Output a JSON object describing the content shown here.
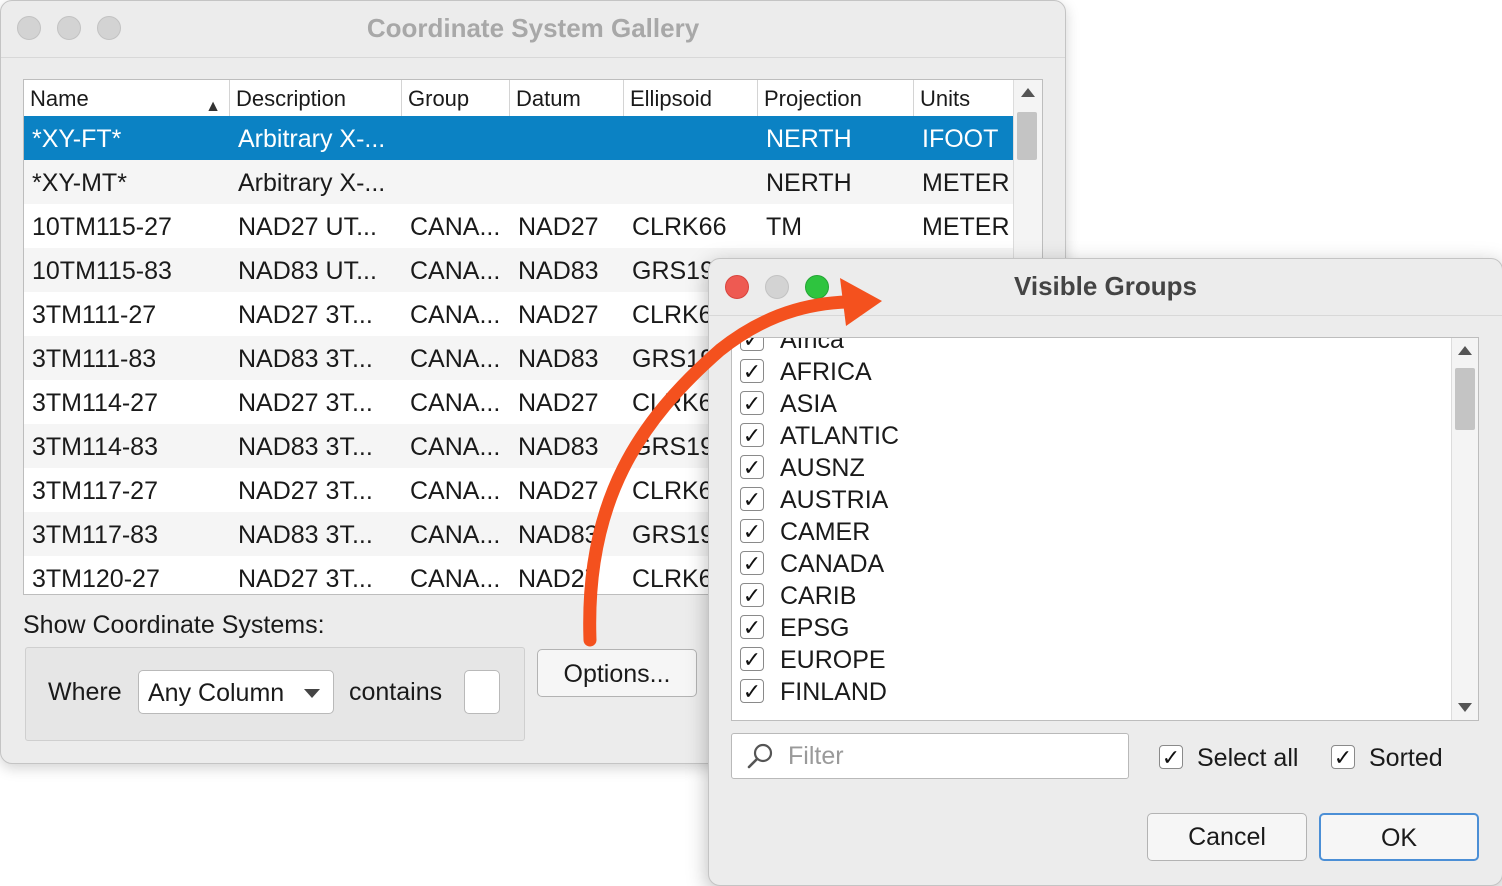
{
  "main_window": {
    "title": "Coordinate System Gallery",
    "columns": [
      {
        "label": "Name"
      },
      {
        "label": "Description"
      },
      {
        "label": "Group"
      },
      {
        "label": "Datum"
      },
      {
        "label": "Ellipsoid"
      },
      {
        "label": "Projection"
      },
      {
        "label": "Units"
      }
    ],
    "rows": [
      {
        "name": "*XY-FT*",
        "description": "Arbitrary X-...",
        "group": "",
        "datum": "",
        "ellipsoid": "",
        "projection": "NERTH",
        "units": "IFOOT",
        "selected": true
      },
      {
        "name": "*XY-MT*",
        "description": "Arbitrary X-...",
        "group": "",
        "datum": "",
        "ellipsoid": "",
        "projection": "NERTH",
        "units": "METER"
      },
      {
        "name": "10TM115-27",
        "description": "NAD27 UT...",
        "group": "CANA...",
        "datum": "NAD27",
        "ellipsoid": "CLRK66",
        "projection": "TM",
        "units": "METER"
      },
      {
        "name": "10TM115-83",
        "description": "NAD83 UT...",
        "group": "CANA...",
        "datum": "NAD83",
        "ellipsoid": "GRS19",
        "projection": "",
        "units": ""
      },
      {
        "name": "3TM111-27",
        "description": "NAD27 3T...",
        "group": "CANA...",
        "datum": "NAD27",
        "ellipsoid": "CLRK6",
        "projection": "",
        "units": ""
      },
      {
        "name": "3TM111-83",
        "description": "NAD83 3T...",
        "group": "CANA...",
        "datum": "NAD83",
        "ellipsoid": "GRS19",
        "projection": "",
        "units": ""
      },
      {
        "name": "3TM114-27",
        "description": "NAD27 3T...",
        "group": "CANA...",
        "datum": "NAD27",
        "ellipsoid": "CLRK6",
        "projection": "",
        "units": ""
      },
      {
        "name": "3TM114-83",
        "description": "NAD83 3T...",
        "group": "CANA...",
        "datum": "NAD83",
        "ellipsoid": "GRS19",
        "projection": "",
        "units": ""
      },
      {
        "name": "3TM117-27",
        "description": "NAD27 3T...",
        "group": "CANA...",
        "datum": "NAD27",
        "ellipsoid": "CLRK6",
        "projection": "",
        "units": ""
      },
      {
        "name": "3TM117-83",
        "description": "NAD83 3T...",
        "group": "CANA...",
        "datum": "NAD83",
        "ellipsoid": "GRS19",
        "projection": "",
        "units": ""
      },
      {
        "name": "3TM120-27",
        "description": "NAD27 3T...",
        "group": "CANA...",
        "datum": "NAD27",
        "ellipsoid": "CLRK6",
        "projection": "",
        "units": ""
      }
    ],
    "show_label": "Show Coordinate Systems:",
    "where_label": "Where",
    "where_value": "Any Column",
    "contains_label": "contains",
    "contains_value": "",
    "options_button": "Options..."
  },
  "dialog": {
    "title": "Visible Groups",
    "groups": [
      {
        "label": "Africa",
        "checked": true
      },
      {
        "label": "AFRICA",
        "checked": true
      },
      {
        "label": "ASIA",
        "checked": true
      },
      {
        "label": "ATLANTIC",
        "checked": true
      },
      {
        "label": "AUSNZ",
        "checked": true
      },
      {
        "label": "AUSTRIA",
        "checked": true
      },
      {
        "label": "CAMER",
        "checked": true
      },
      {
        "label": "CANADA",
        "checked": true
      },
      {
        "label": "CARIB",
        "checked": true
      },
      {
        "label": "EPSG",
        "checked": true
      },
      {
        "label": "EUROPE",
        "checked": true
      },
      {
        "label": "FINLAND",
        "checked": true
      }
    ],
    "filter_placeholder": "Filter",
    "select_all_label": "Select all",
    "select_all_checked": true,
    "sorted_label": "Sorted",
    "sorted_checked": true,
    "cancel_button": "Cancel",
    "ok_button": "OK"
  },
  "colors": {
    "selection": "#0b82c4",
    "annotation_arrow": "#f4511e",
    "close_red": "#ee5a52",
    "zoom_green": "#2ec43f"
  },
  "icons": {
    "search": "magnifier-icon",
    "check": "✓"
  }
}
